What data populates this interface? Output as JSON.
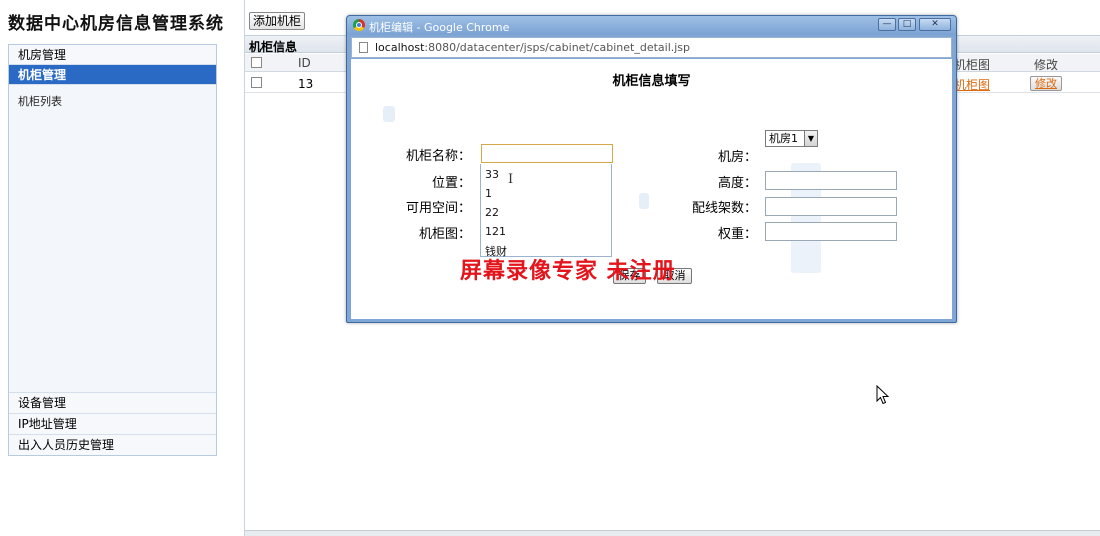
{
  "app": {
    "title": "数据中心机房信息管理系统"
  },
  "sidebar": {
    "sections_top": [
      {
        "label": "机房管理",
        "active": false
      },
      {
        "label": "机柜管理",
        "active": true
      }
    ],
    "links": [
      {
        "label": "机柜列表"
      }
    ],
    "sections_bottom": [
      {
        "label": "设备管理"
      },
      {
        "label": "IP地址管理"
      },
      {
        "label": "出入人员历史管理"
      }
    ]
  },
  "main": {
    "add_button": "添加机柜",
    "table_title": "机柜信息",
    "columns": {
      "id": "ID",
      "diagram": "机柜图",
      "edit": "修改"
    },
    "rows": [
      {
        "id": "13",
        "diagram_link": "机柜图",
        "edit_button": "修改"
      }
    ]
  },
  "popup": {
    "window_title": "机柜编辑 - Google Chrome",
    "url_host": "localhost",
    "url_rest": ":8080/datacenter/jsps/cabinet/cabinet_detail.jsp",
    "form": {
      "heading": "机柜信息填写",
      "labels": {
        "name": "机柜名称：",
        "position": "位置：",
        "space": "可用空间：",
        "diagram": "机柜图：",
        "room": "机房：",
        "height": "高度：",
        "racks": "配线架数：",
        "weight": "权重："
      },
      "values": {
        "name": "",
        "room": "机房1",
        "height": "",
        "racks": "",
        "weight": ""
      },
      "autocomplete_options": [
        "33",
        "1",
        "22",
        "121",
        "钱财"
      ],
      "save_button": "保存",
      "cancel_button": "取消"
    },
    "watermark": "屏幕录像专家  未注册"
  },
  "icons": {
    "window_controls": [
      "minimize-icon",
      "maximize-icon",
      "close-icon"
    ],
    "cursor": "mouse-pointer-icon"
  },
  "colors": {
    "sidebar_active": "#2a6ac4",
    "link_orange": "#e06a10",
    "watermark_red": "#e3141b",
    "popup_frame": "#7fa6d4"
  }
}
